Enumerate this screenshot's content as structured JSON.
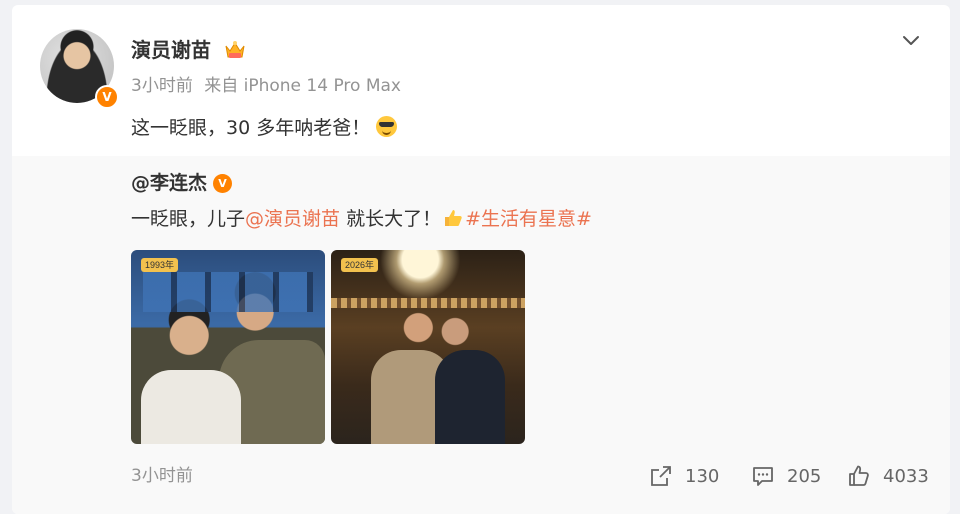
{
  "post": {
    "author": "演员谢苗",
    "avatar_badge": "V",
    "time": "3小时前",
    "source": "来自 iPhone 14 Pro Max",
    "text": "这一眨眼，30 多年呐老爸！",
    "emoji": "cool-sunglasses-emoji",
    "menu_icon": "chevron-down-icon"
  },
  "repost": {
    "author": "@李连杰",
    "badge": "V",
    "text_before": "一眨眼，儿子",
    "mention": "@演员谢苗",
    "text_after": " 就长大了！",
    "thumbs_icon": "thumbs-up-emoji",
    "topic": "#生活有星意#",
    "photos": [
      {
        "label": "1993年",
        "desc": "old-photo"
      },
      {
        "label": "2026年",
        "desc": "new-photo"
      }
    ],
    "time": "3小时前"
  },
  "actions": {
    "share_count": "130",
    "comment_count": "205",
    "like_count": "4033"
  },
  "colors": {
    "link": "#eb7350",
    "verified": "#ff8200",
    "meta": "#939393"
  }
}
